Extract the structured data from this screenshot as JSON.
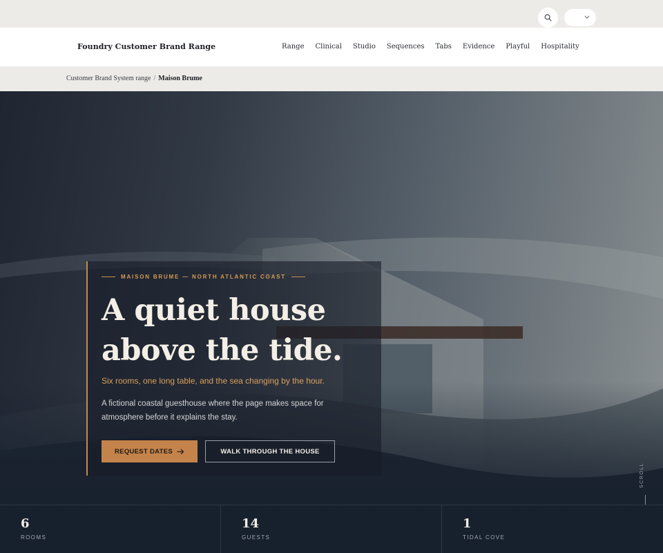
{
  "utility": {
    "search_icon": "search-icon",
    "select_icon": "chevron-down-icon"
  },
  "nav": {
    "brand": "Foundry Customer Brand Range",
    "links": [
      "Range",
      "Clinical",
      "Studio",
      "Sequences",
      "Tabs",
      "Evidence",
      "Playful",
      "Hospitality"
    ]
  },
  "breadcrumb": {
    "parent": "Customer Brand System range",
    "separator": "/",
    "current": "Maison Brume"
  },
  "hero": {
    "eyebrow": "MAISON BRUME — NORTH ATLANTIC COAST",
    "headline_line1": "A quiet house",
    "headline_line2": "above the tide.",
    "tagline": "Six rooms, one long table, and the sea changing by the hour.",
    "description": "A fictional coastal guesthouse where the page makes space for atmosphere before it explains the stay.",
    "primary_cta": "REQUEST DATES",
    "secondary_cta": "WALK THROUGH THE HOUSE",
    "scroll_label": "SCROLL"
  },
  "stats": [
    {
      "value": "6",
      "label": "ROOMS"
    },
    {
      "value": "14",
      "label": "GUESTS"
    },
    {
      "value": "1",
      "label": "TIDAL COVE"
    }
  ],
  "colors": {
    "accent": "#c4834a",
    "accent_text": "#d9a05c",
    "dark": "#17202d",
    "cream": "#f3efe6"
  }
}
